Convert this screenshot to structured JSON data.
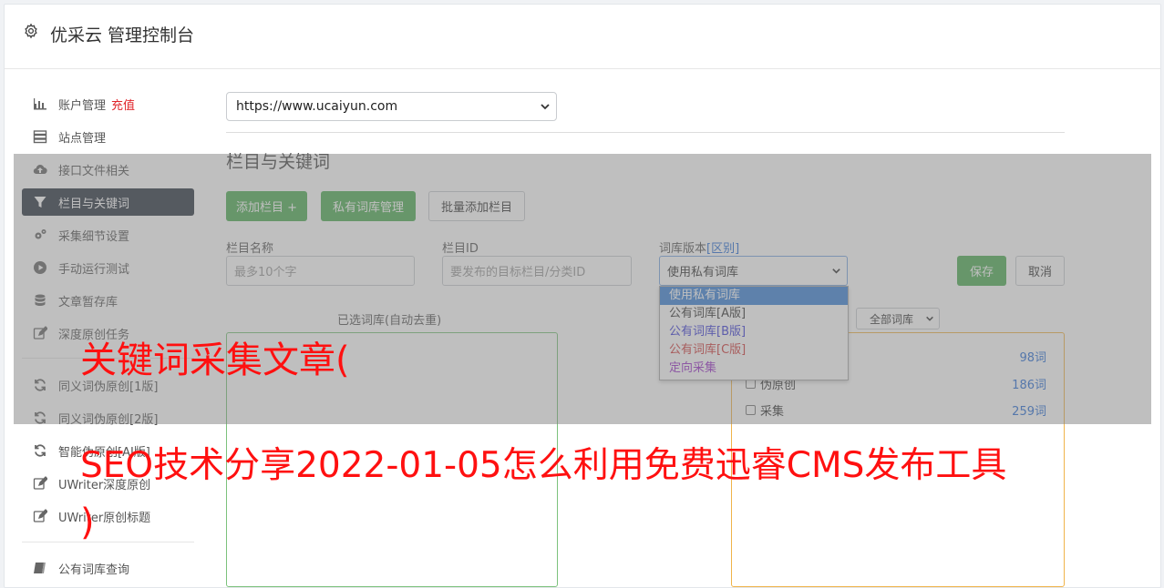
{
  "header": {
    "title": "优采云 管理控制台",
    "icon": "gear-icon"
  },
  "sidebar": {
    "items": [
      {
        "label": "账户管理",
        "badge": "充值",
        "icon": "bar-chart-icon"
      },
      {
        "label": "站点管理",
        "icon": "server-icon"
      },
      {
        "label": "接口文件相关",
        "icon": "cloud-upload-icon"
      },
      {
        "label": "栏目与关键词",
        "icon": "filter-icon",
        "active": true
      },
      {
        "label": "采集细节设置",
        "icon": "gears-icon"
      },
      {
        "label": "手动运行测试",
        "icon": "play-circle-icon"
      },
      {
        "label": "文章暂存库",
        "icon": "database-icon"
      },
      {
        "label": "深度原创任务",
        "icon": "edit-icon"
      },
      {
        "label": "同义词伪原创[1版]",
        "icon": "refresh-icon"
      },
      {
        "label": "同义词伪原创[2版]",
        "icon": "refresh-icon"
      },
      {
        "label": "智能伪原创[AI版]",
        "icon": "refresh-icon"
      },
      {
        "label": "UWriter深度原创",
        "icon": "edit-icon"
      },
      {
        "label": "UWriter原创标题",
        "icon": "edit-icon"
      },
      {
        "label": "公有词库查询",
        "icon": "book-icon"
      }
    ]
  },
  "main": {
    "site_select": {
      "value": "https://www.ucaiyun.com"
    },
    "section_title": "栏目与关键词",
    "buttons": {
      "add_column": "添加栏目 +",
      "private_lib": "私有词库管理",
      "batch_add": "批量添加栏目"
    },
    "form": {
      "name_label": "栏目名称",
      "name_placeholder": "最多10个字",
      "id_label": "栏目ID",
      "id_placeholder": "要发布的目标栏目/分类ID",
      "lib_label": "词库版本",
      "lib_label_link": "[区别]",
      "lib_selected": "使用私有词库",
      "lib_options": [
        {
          "label": "使用私有词库",
          "color": "#ffffff",
          "selected": true
        },
        {
          "label": "公有词库[A版]",
          "color": "#333333"
        },
        {
          "label": "公有词库[B版]",
          "color": "#3a3ad6"
        },
        {
          "label": "公有词库[C版]",
          "color": "#d03a3a"
        },
        {
          "label": "定向采集",
          "color": "#9b30c8"
        }
      ],
      "save": "保存",
      "cancel": "取消"
    },
    "selected_caption": "已选词库(自动去重)",
    "lib_filter": "全部词库",
    "lib_list": [
      {
        "label": "",
        "count": "98词"
      },
      {
        "label": "伪原创",
        "count": "186词"
      },
      {
        "label": "采集",
        "count": "259词"
      }
    ]
  },
  "overlay": {
    "line1": "关键词采集文章(",
    "line2": "SEO技术分享2022-01-05怎么利用免费迅睿CMS发布工具",
    "line3": ")"
  },
  "colors": {
    "accent_green": "#4ead55",
    "active_sidebar": "#2b3440",
    "overlay_red": "#ff1010"
  }
}
